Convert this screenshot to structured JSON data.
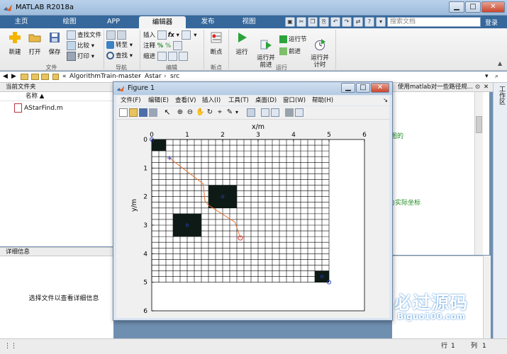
{
  "window": {
    "title": "MATLAB R2018a"
  },
  "tabs": [
    "主页",
    "绘图",
    "APP",
    "编辑器",
    "发布",
    "视图"
  ],
  "active_tab": "编辑器",
  "search": {
    "placeholder": "搜索文档"
  },
  "login_label": "登录",
  "ribbon": {
    "file": {
      "new": "新建",
      "open": "打开",
      "save": "保存",
      "find_files": "查找文件",
      "compare": "比较",
      "print": "打印",
      "group": "文件"
    },
    "navigate": {
      "goto": "转至",
      "find": "查找",
      "group": "导航"
    },
    "edit": {
      "insert": "插入",
      "comment": "注释",
      "indent": "缩进",
      "fx": "fx",
      "group": "编辑"
    },
    "breakpoints": {
      "label": "断点",
      "group": "断点"
    },
    "run": {
      "run": "运行",
      "run_advance": "运行并\n前进",
      "run_section": "运行节",
      "advance": "前进",
      "run_time": "运行并\n计时",
      "group": "运行"
    }
  },
  "path": {
    "segments": [
      "«",
      "AlgorithmTrain-master",
      "Astar",
      "src"
    ],
    "separator": "›"
  },
  "current_folder": {
    "header": "当前文件夹",
    "name_col": "名称 ▲",
    "files": [
      "AStarFind.m"
    ]
  },
  "details": {
    "header": "详细信息",
    "empty": "选择文件以查看详细信息"
  },
  "editor": {
    "header_text": "使用matlab对一些路径规...",
    "comments": [
      "地图的",
      "为实际坐标"
    ]
  },
  "workspace_tab": "工作区",
  "status": {
    "row_label": "行",
    "row": "1",
    "col_label": "列",
    "col": "1"
  },
  "watermark": {
    "cn": "必过源码",
    "url": "Biguo100.com"
  },
  "figure": {
    "title": "Figure 1",
    "menu": [
      "文件(F)",
      "编辑(E)",
      "查看(V)",
      "插入(I)",
      "工具(T)",
      "桌面(D)",
      "窗口(W)",
      "帮助(H)"
    ]
  },
  "chart_data": {
    "type": "scatter",
    "title": "",
    "xlabel": "x/m",
    "ylabel": "y/m",
    "xlim": [
      0,
      6
    ],
    "ylim": [
      6,
      0
    ],
    "x_ticks": [
      0,
      1,
      2,
      3,
      4,
      5,
      6
    ],
    "y_ticks": [
      0,
      1,
      2,
      3,
      4,
      5,
      6
    ],
    "x_axis_location": "top",
    "y_direction": "reversed",
    "grid": {
      "map_extent": [
        0,
        5
      ],
      "cell_size": 0.2
    },
    "obstacles": [
      {
        "x": [
          0,
          0.4
        ],
        "y": [
          0,
          0.4
        ]
      },
      {
        "x": [
          1.6,
          2.4
        ],
        "y": [
          1.6,
          2.4
        ]
      },
      {
        "x": [
          0.6,
          1.4
        ],
        "y": [
          2.6,
          3.4
        ]
      },
      {
        "x": [
          4.6,
          5.0
        ],
        "y": [
          4.6,
          5.0
        ]
      }
    ],
    "obstacle_centers": [
      {
        "x": 2.0,
        "y": 2.0
      },
      {
        "x": 1.0,
        "y": 3.0
      },
      {
        "x": 4.8,
        "y": 4.8
      }
    ],
    "start": {
      "x": 0.5,
      "y": 0.65
    },
    "goal": {
      "x": 2.5,
      "y": 3.45
    },
    "path": [
      {
        "x": 0.5,
        "y": 0.65
      },
      {
        "x": 1.45,
        "y": 1.55
      },
      {
        "x": 1.5,
        "y": 2.15
      },
      {
        "x": 1.6,
        "y": 2.3
      },
      {
        "x": 2.35,
        "y": 2.9
      },
      {
        "x": 2.5,
        "y": 3.45
      }
    ],
    "circle_markers": [
      {
        "x": 0,
        "y": 0
      },
      {
        "x": 5,
        "y": 5
      }
    ],
    "colors": {
      "obstacle": "#0e1a16",
      "path": "#e8702a",
      "goal": "#d9363e",
      "marker": "#2b3fc8",
      "grid": "#000000"
    }
  }
}
